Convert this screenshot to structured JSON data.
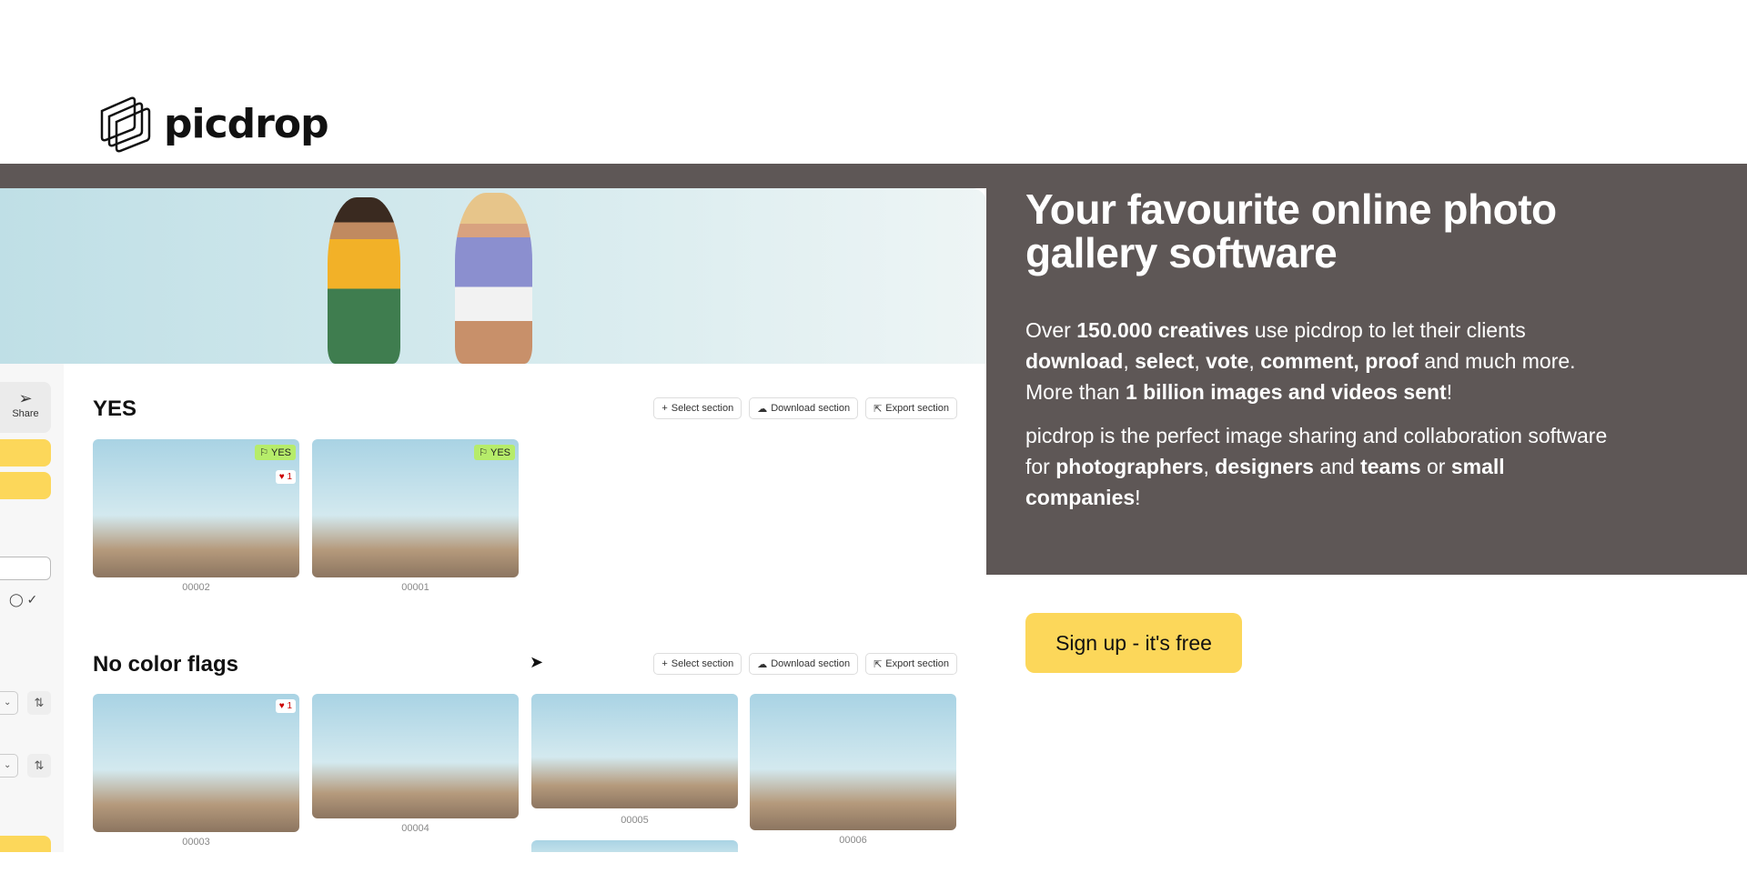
{
  "logo": {
    "text": "picdrop"
  },
  "hero": {
    "title": "Your favourite online photo gallery software",
    "p1": [
      {
        "t": "Over ",
        "b": false
      },
      {
        "t": "150.000 creatives",
        "b": true
      },
      {
        "t": " use picdrop to let their clients ",
        "b": false
      },
      {
        "t": "download",
        "b": true
      },
      {
        "t": ", ",
        "b": false
      },
      {
        "t": "select",
        "b": true
      },
      {
        "t": ", ",
        "b": false
      },
      {
        "t": "vote",
        "b": true
      },
      {
        "t": ", ",
        "b": false
      },
      {
        "t": "comment, proof",
        "b": true
      },
      {
        "t": " and much more. More than ",
        "b": false
      },
      {
        "t": "1 billion images and videos sent",
        "b": true
      },
      {
        "t": "!",
        "b": false
      }
    ],
    "p2": [
      {
        "t": "picdrop is the perfect image sharing and collaboration software for ",
        "b": false
      },
      {
        "t": "photographers",
        "b": true
      },
      {
        "t": ", ",
        "b": false
      },
      {
        "t": "designers",
        "b": true
      },
      {
        "t": " and ",
        "b": false
      },
      {
        "t": "teams",
        "b": true
      },
      {
        "t": " or ",
        "b": false
      },
      {
        "t": "small companies",
        "b": true
      },
      {
        "t": "!",
        "b": false
      }
    ],
    "cta": "Sign up - it's free"
  },
  "app": {
    "share_label": "Share",
    "section_buttons": {
      "select": "Select section",
      "download": "Download section",
      "export": "Export section"
    },
    "sections": [
      {
        "title": "YES",
        "images": [
          {
            "id": "00002",
            "flag": "YES",
            "likes": "1"
          },
          {
            "id": "00001",
            "flag": "YES"
          }
        ]
      },
      {
        "title": "No color flags",
        "images": [
          {
            "id": "00003",
            "likes": "1"
          },
          {
            "id": "00004"
          },
          {
            "id": "00005"
          },
          {
            "id": "00006"
          }
        ]
      }
    ]
  },
  "colors": {
    "band": "#5e5756",
    "accent": "#fcd75a",
    "flag": "#b6ec6a"
  }
}
